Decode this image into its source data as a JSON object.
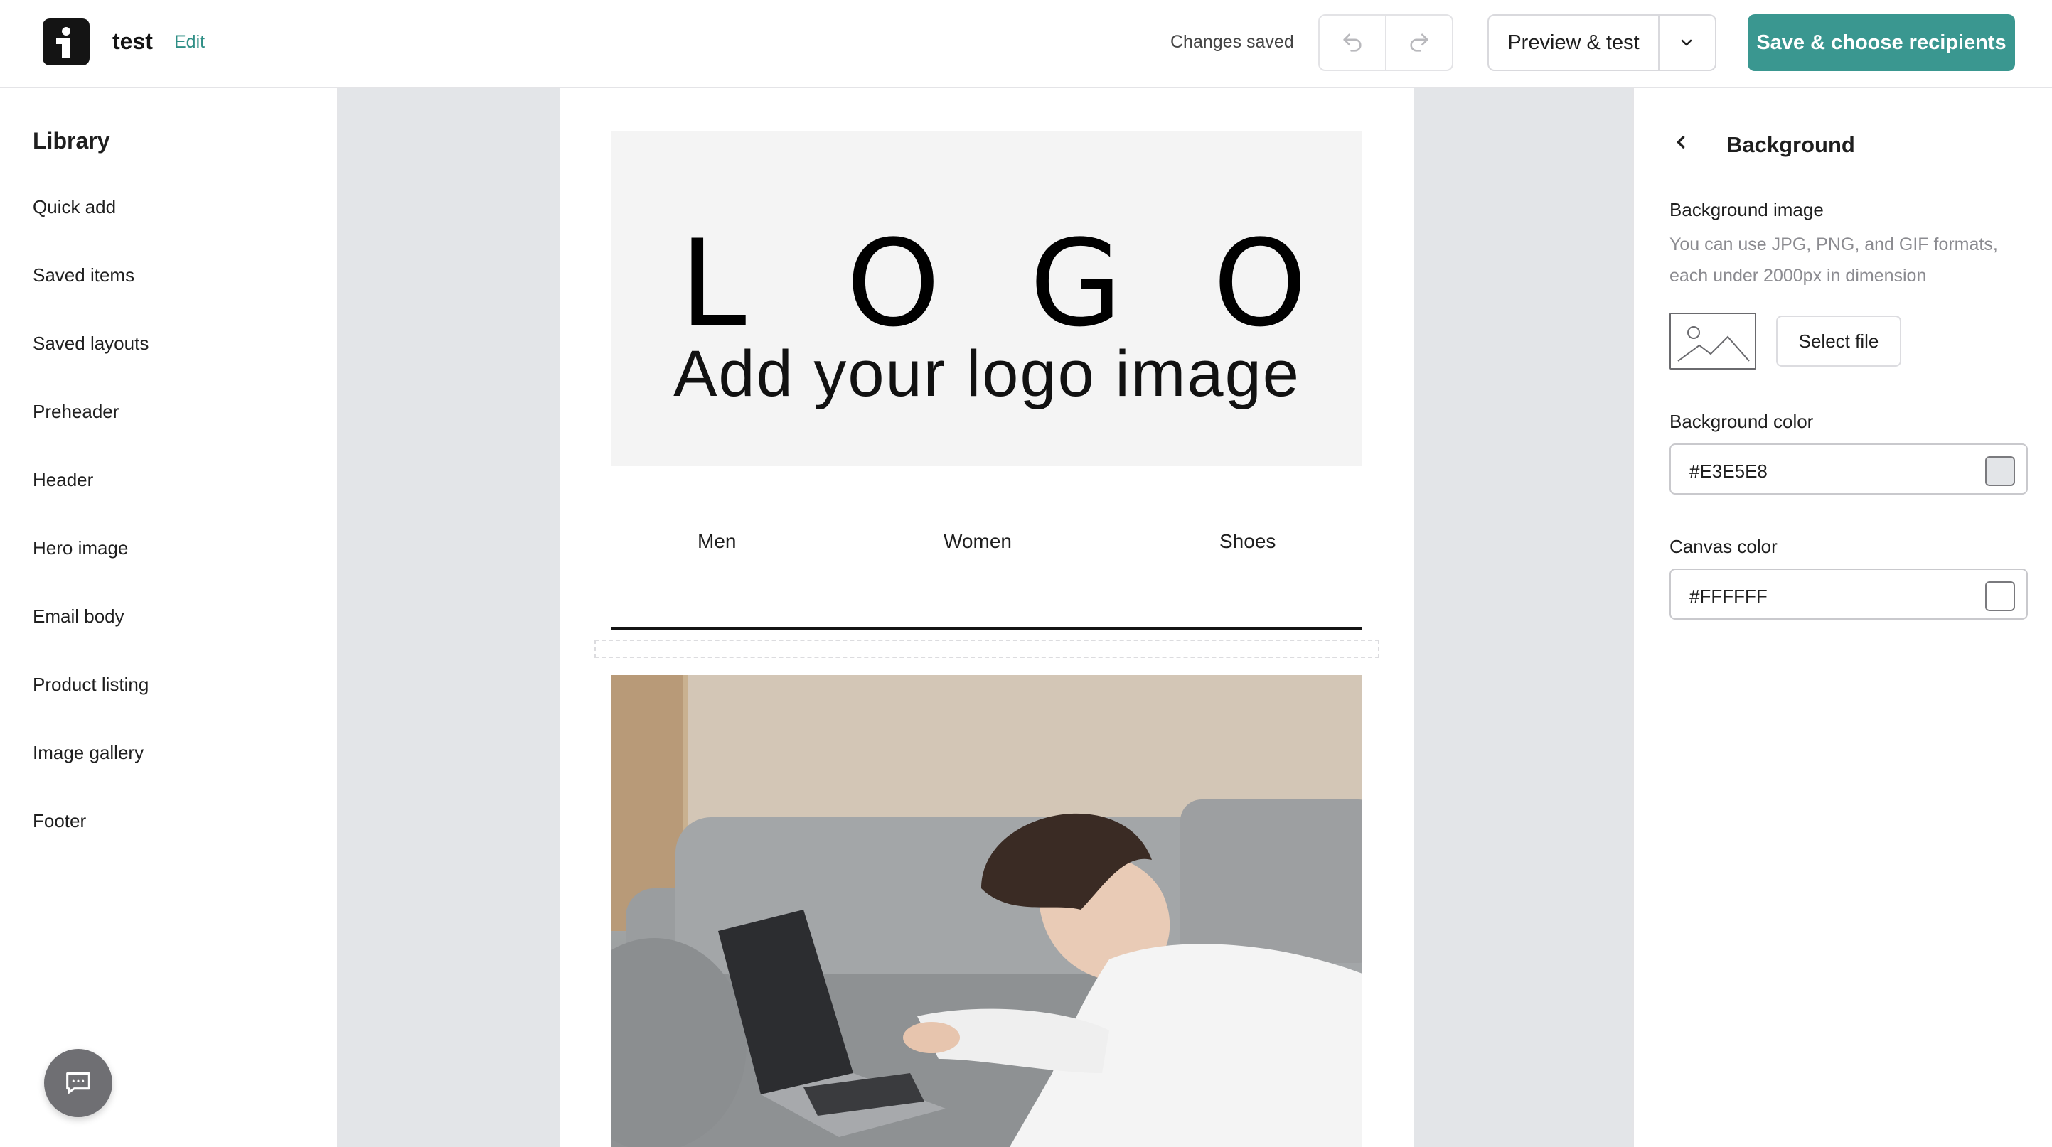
{
  "header": {
    "doc_title": "test",
    "edit_label": "Edit",
    "status": "Changes saved",
    "preview_label": "Preview & test",
    "save_label": "Save & choose recipients",
    "accent": "#3a9790"
  },
  "sidebar": {
    "title": "Library",
    "items": [
      {
        "label": "Quick add"
      },
      {
        "label": "Saved items"
      },
      {
        "label": "Saved layouts"
      },
      {
        "label": "Preheader"
      },
      {
        "label": "Header"
      },
      {
        "label": "Hero image"
      },
      {
        "label": "Email body"
      },
      {
        "label": "Product listing"
      },
      {
        "label": "Image gallery"
      },
      {
        "label": "Footer"
      }
    ]
  },
  "email": {
    "logo_letters": [
      "L",
      "O",
      "G",
      "O"
    ],
    "logo_caption": "Add your logo image",
    "nav": [
      "Men",
      "Women",
      "Shoes"
    ]
  },
  "panel": {
    "title": "Background",
    "bg_image_label": "Background image",
    "bg_image_hint": "You can use JPG, PNG, and GIF formats, each under 2000px in dimension",
    "select_file_label": "Select file",
    "bg_color_label": "Background color",
    "bg_color_value": "#E3E5E8",
    "canvas_color_label": "Canvas color",
    "canvas_color_value": "#FFFFFF"
  }
}
